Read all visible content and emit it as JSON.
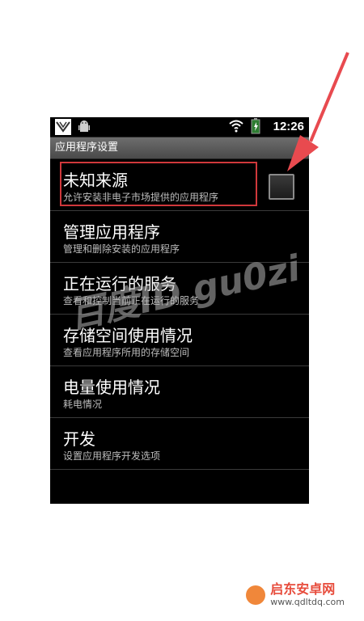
{
  "statusbar": {
    "time": "12:26",
    "icons": [
      "wind-app-icon",
      "android-icon",
      "wifi-icon",
      "battery-icon"
    ]
  },
  "header": {
    "title": "应用程序设置"
  },
  "list": {
    "items": [
      {
        "title": "未知来源",
        "subtitle": "允许安装非电子市场提供的应用程序",
        "checkbox": true,
        "highlighted": true
      },
      {
        "title": "管理应用程序",
        "subtitle": "管理和删除安装的应用程序"
      },
      {
        "title": "正在运行的服务",
        "subtitle": "查看和控制当前正在运行的服务"
      },
      {
        "title": "存储空间使用情况",
        "subtitle": "查看应用程序所用的存储空间"
      },
      {
        "title": "电量使用情况",
        "subtitle": "耗电情况"
      },
      {
        "title": "开发",
        "subtitle": "设置应用程序开发选项"
      }
    ]
  },
  "watermark": "百度ID gu0zi",
  "brand": {
    "name": "启东安卓网",
    "url": "www.qdltdq.com"
  },
  "colors": {
    "highlight": "#d0383b",
    "background": "#000000"
  }
}
